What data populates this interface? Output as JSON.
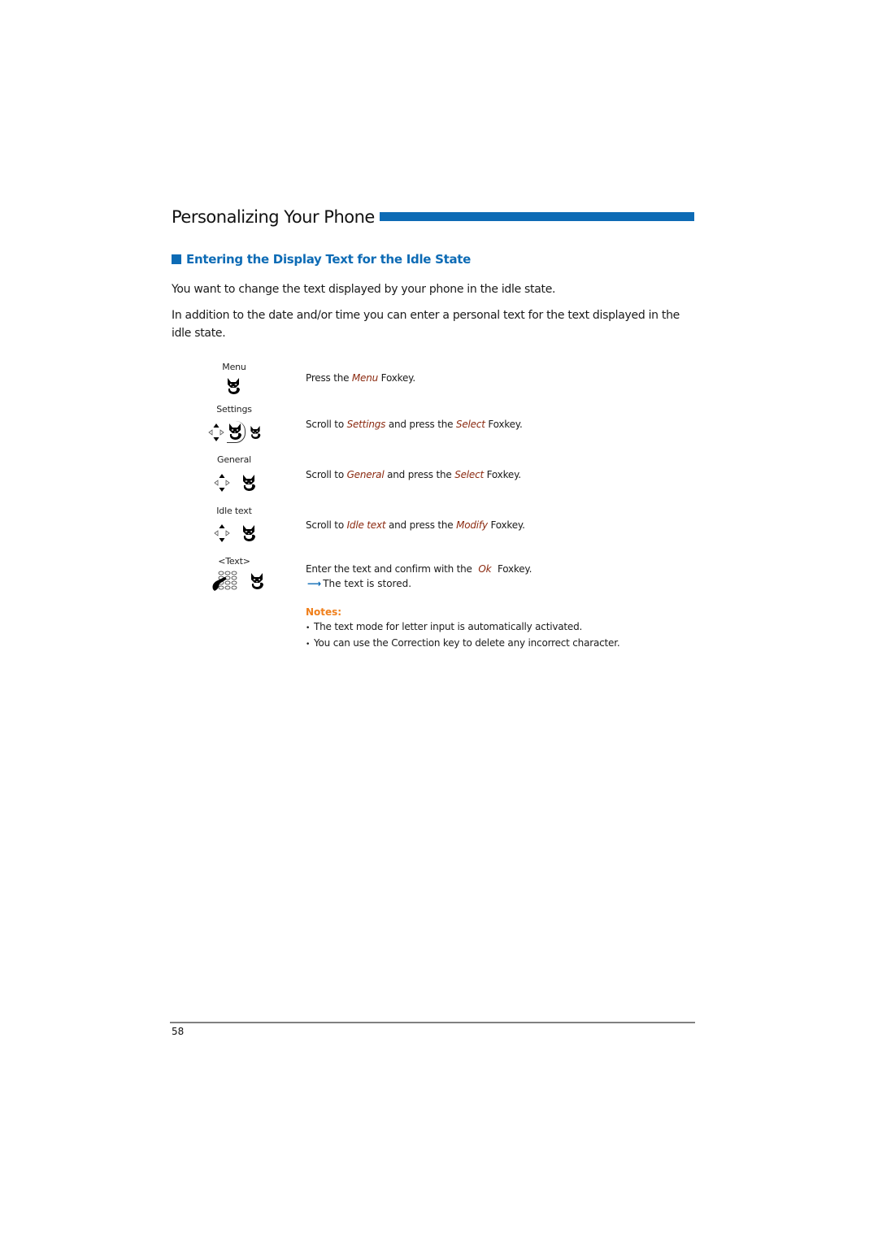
{
  "chapter": {
    "title": "Personalizing Your Phone",
    "accent_color": "#0d6bb5"
  },
  "section": {
    "title": "Entering the Display Text for the Idle State"
  },
  "paragraphs": [
    "You want to change the text displayed by your phone in the idle state.",
    "In addition to the date and/or time you can enter a personal text for the text displayed in the idle state."
  ],
  "steps": [
    {
      "label": "Menu",
      "icons": [
        "foxkey-icon"
      ],
      "text": {
        "before": "Press the ",
        "highlight": "Menu",
        "after": " Foxkey."
      }
    },
    {
      "label": "Settings",
      "icons": [
        "navigation-key-icon",
        "foxkey-icon",
        "foxkey-icon"
      ],
      "text": {
        "before": "Scroll to ",
        "highlight": "Settings",
        "middle": " and press the ",
        "highlight2": "Select",
        "after": " Foxkey."
      }
    },
    {
      "label": "General",
      "icons": [
        "navigation-key-icon",
        "foxkey-icon"
      ],
      "text": {
        "before": "Scroll to ",
        "highlight": "General",
        "middle": " and press the ",
        "highlight2": "Select",
        "after": " Foxkey."
      }
    },
    {
      "label": "Idle text",
      "icons": [
        "navigation-key-icon",
        "foxkey-icon"
      ],
      "text": {
        "before": "Scroll to ",
        "highlight": "Idle text",
        "middle": " and press the ",
        "highlight2": "Modify",
        "after": " Foxkey."
      }
    },
    {
      "label": "<Text>",
      "icons": [
        "keypad-icon",
        "foxkey-icon"
      ],
      "text": {
        "before": "Enter the text and confirm with the ",
        "highlight": "Ok",
        "after": " Foxkey."
      },
      "result": "The text is stored."
    }
  ],
  "notes": {
    "title": "Notes:",
    "items": [
      "The text mode for letter input is automatically activated.",
      "You can use the Correction key to delete any incorrect character."
    ]
  },
  "footer": {
    "page_number": "58"
  },
  "colors": {
    "heading_blue": "#0d6bb5",
    "highlight_red": "#8b2a10",
    "notes_orange": "#f07f1a"
  }
}
